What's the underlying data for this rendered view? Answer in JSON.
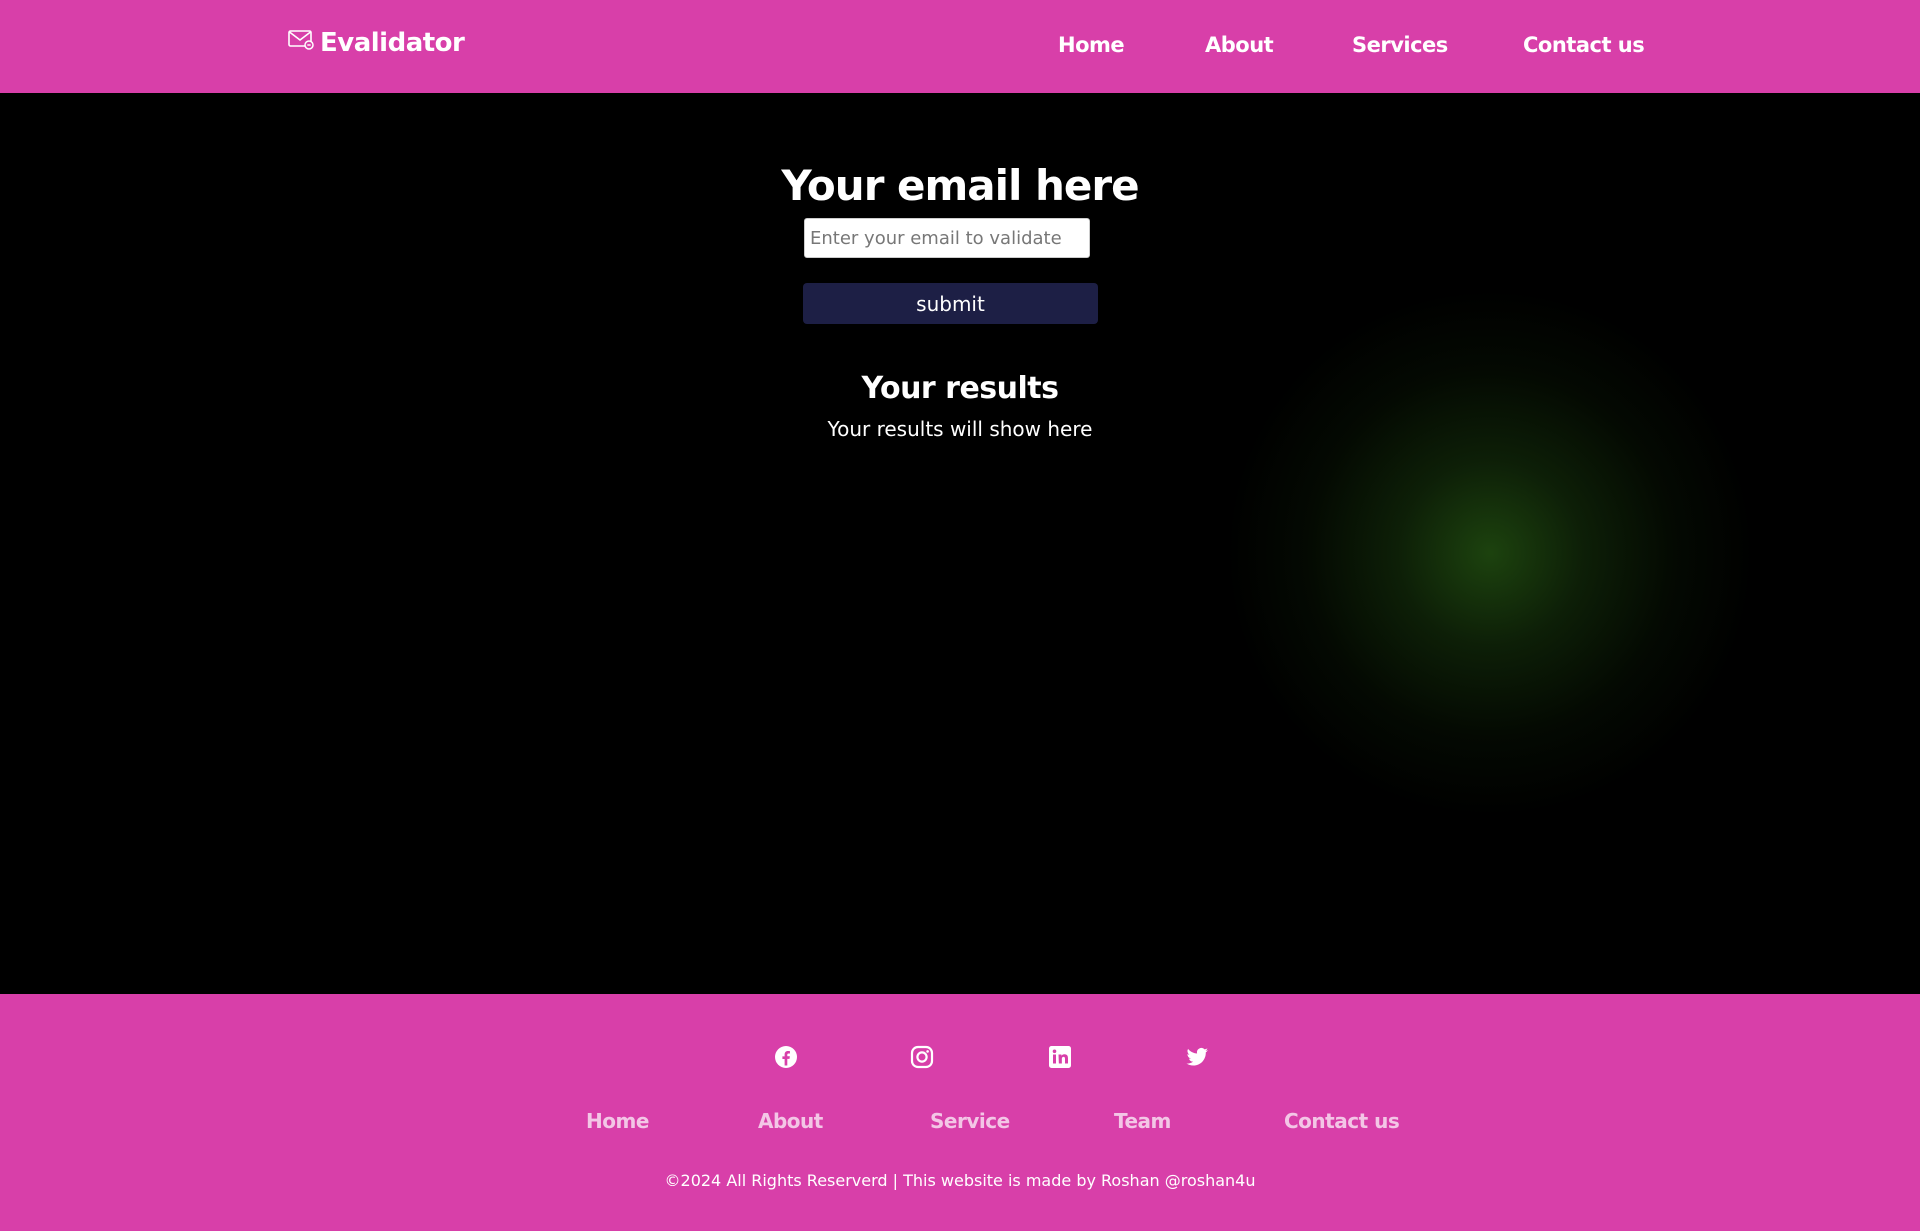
{
  "header": {
    "brand_icon": "envelope-icon",
    "brand_name": "Evalidator",
    "nav": [
      {
        "label": "Home"
      },
      {
        "label": "About"
      },
      {
        "label": "Services"
      },
      {
        "label": "Contact us"
      }
    ]
  },
  "main": {
    "email_title": "Your email here",
    "email_input": {
      "value": "",
      "placeholder": "Enter your email to validate"
    },
    "submit_label": "submit",
    "results_title": "Your results",
    "results_text": "Your results will show here"
  },
  "footer": {
    "social_icons": [
      "facebook-icon",
      "instagram-icon",
      "linkedin-icon",
      "twitter-icon"
    ],
    "links": [
      {
        "label": "Home"
      },
      {
        "label": "About"
      },
      {
        "label": "Service"
      },
      {
        "label": "Team"
      },
      {
        "label": "Contact us"
      }
    ],
    "copyright": "©2024 All Rights Reserverd | This website is made by Roshan @roshan4u"
  },
  "colors": {
    "brand_pink": "#d83fa9",
    "background": "#000000",
    "button": "#1d1f45",
    "footer_link": "#f3c6e6"
  }
}
